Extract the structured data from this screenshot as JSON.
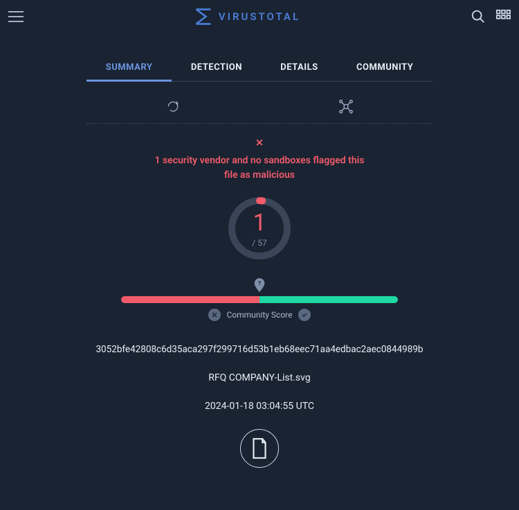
{
  "brand": {
    "name": "VIRUSTOTAL"
  },
  "tabs": [
    {
      "label": "SUMMARY",
      "active": true
    },
    {
      "label": "DETECTION",
      "active": false
    },
    {
      "label": "DETAILS",
      "active": false
    },
    {
      "label": "COMMUNITY",
      "active": false
    }
  ],
  "alert": {
    "message_line1": "1 security vendor and no sandboxes flagged this",
    "message_line2": "file as malicious"
  },
  "score": {
    "detections": "1",
    "total": "/ 57",
    "community_label": "Community Score",
    "bar_negative_pct": 50,
    "bar_positive_pct": 50
  },
  "file": {
    "hash": "3052bfe42808c6d35aca297f299716d53b1eb68eec71aa4edbac2aec0844989b",
    "name": "RFQ COMPANY-List.svg",
    "timestamp": "2024-01-18 03:04:55 UTC"
  },
  "icons": {
    "menu": "menu",
    "search": "search",
    "apps": "apps"
  }
}
